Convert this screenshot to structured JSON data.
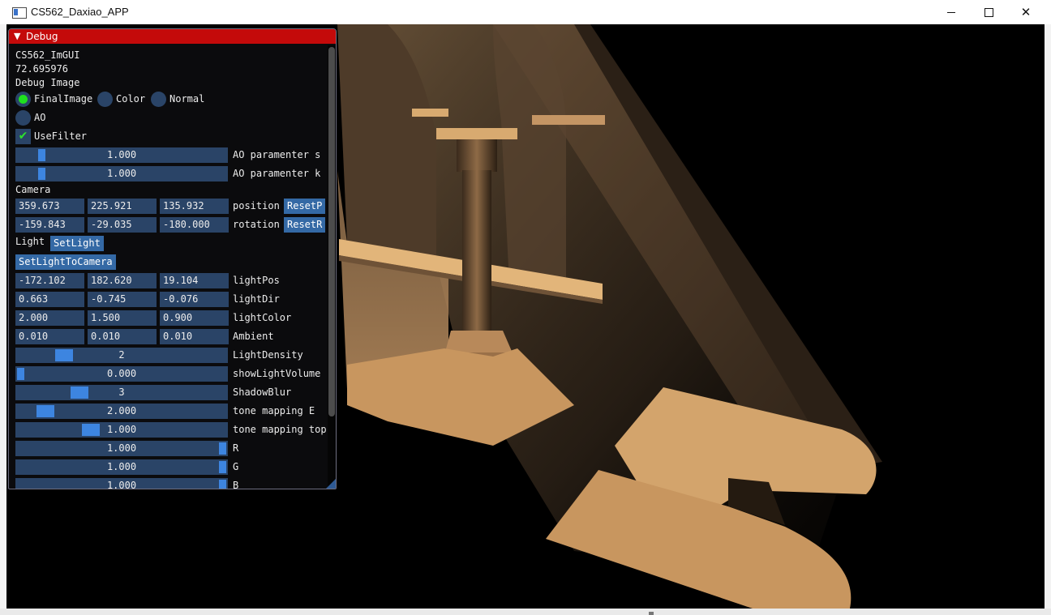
{
  "window": {
    "title": "CS562_Daxiao_APP",
    "minimize_glyph": "—",
    "maximize_glyph": "☐",
    "close_glyph": "✕"
  },
  "panel": {
    "title": "Debug",
    "lines": {
      "app_name": "CS562_ImGUI",
      "fps": "72.695976",
      "debug_image": "Debug Image"
    },
    "radios": [
      {
        "label": "FinalImage",
        "selected": true
      },
      {
        "label": "Color",
        "selected": false
      },
      {
        "label": "Normal",
        "selected": false
      },
      {
        "label": "AO",
        "selected": false
      }
    ],
    "use_filter": {
      "label": "UseFilter",
      "checked": true
    },
    "ao_s": {
      "value": "1.000",
      "label": "AO paramenter s"
    },
    "ao_k": {
      "value": "1.000",
      "label": "AO paramenter k"
    },
    "camera_header": "Camera",
    "position": {
      "x": "359.673",
      "y": "225.921",
      "z": "135.932",
      "label": "position",
      "button": "ResetP"
    },
    "rotation": {
      "x": "-159.843",
      "y": "-29.035",
      "z": "-180.000",
      "label": "rotation",
      "button": "ResetR"
    },
    "light_header": "Light",
    "set_light_button": "SetLight",
    "set_light_to_camera_button": "SetLightToCamera",
    "light_pos": {
      "x": "-172.102",
      "y": "182.620",
      "z": "19.104",
      "label": "lightPos"
    },
    "light_dir": {
      "x": "0.663",
      "y": "-0.745",
      "z": "-0.076",
      "label": "lightDir"
    },
    "light_color": {
      "x": "2.000",
      "y": "1.500",
      "z": "0.900",
      "label": "lightColor"
    },
    "ambient": {
      "x": "0.010",
      "y": "0.010",
      "z": "0.010",
      "label": "Ambient"
    },
    "sliders": [
      {
        "value": "2",
        "label": "LightDensity",
        "fill": 0.2
      },
      {
        "value": "0.000",
        "label": "showLightVolume",
        "fill": 0.0
      },
      {
        "value": "3",
        "label": "ShadowBlur",
        "fill": 0.28
      },
      {
        "value": "2.000",
        "label": "tone mapping E",
        "fill": 0.1
      },
      {
        "value": "1.000",
        "label": "tone mapping top",
        "fill": 0.34
      },
      {
        "value": "1.000",
        "label": "R",
        "fill": 1.0
      },
      {
        "value": "1.000",
        "label": "G",
        "fill": 1.0
      },
      {
        "value": "1.000",
        "label": "B",
        "fill": 1.0
      }
    ]
  },
  "colors": {
    "title_bar_active": "#c40a0a",
    "frame_bg": "#2a4467",
    "slider_grab": "#3d85e0",
    "radio_active": "#1fe01f",
    "button": "#3469a5",
    "lit_surface": "#c8965f"
  }
}
